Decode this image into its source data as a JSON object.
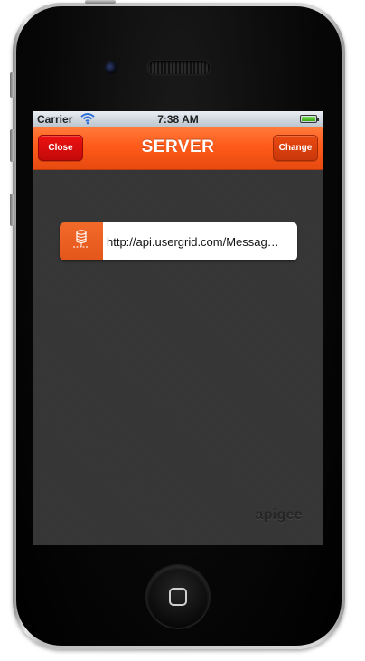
{
  "status_bar": {
    "carrier": "Carrier",
    "time": "7:38 AM",
    "wifi_icon": "wifi-icon",
    "battery_icon": "battery-icon",
    "battery_level": 1.0
  },
  "nav_bar": {
    "title": "SERVER",
    "left_button_label": "Close",
    "right_button_label": "Change",
    "accent_color": "#ff5a1a",
    "close_color": "#dd1111"
  },
  "server": {
    "icon": "database-server-icon",
    "url": "http://api.usergrid.com/Messag…"
  },
  "branding": {
    "logo_text": "apigee"
  },
  "device": {
    "home_button_icon": "home-square-icon",
    "camera_icon": "front-camera-icon",
    "speaker_icon": "earpiece-speaker-icon"
  }
}
